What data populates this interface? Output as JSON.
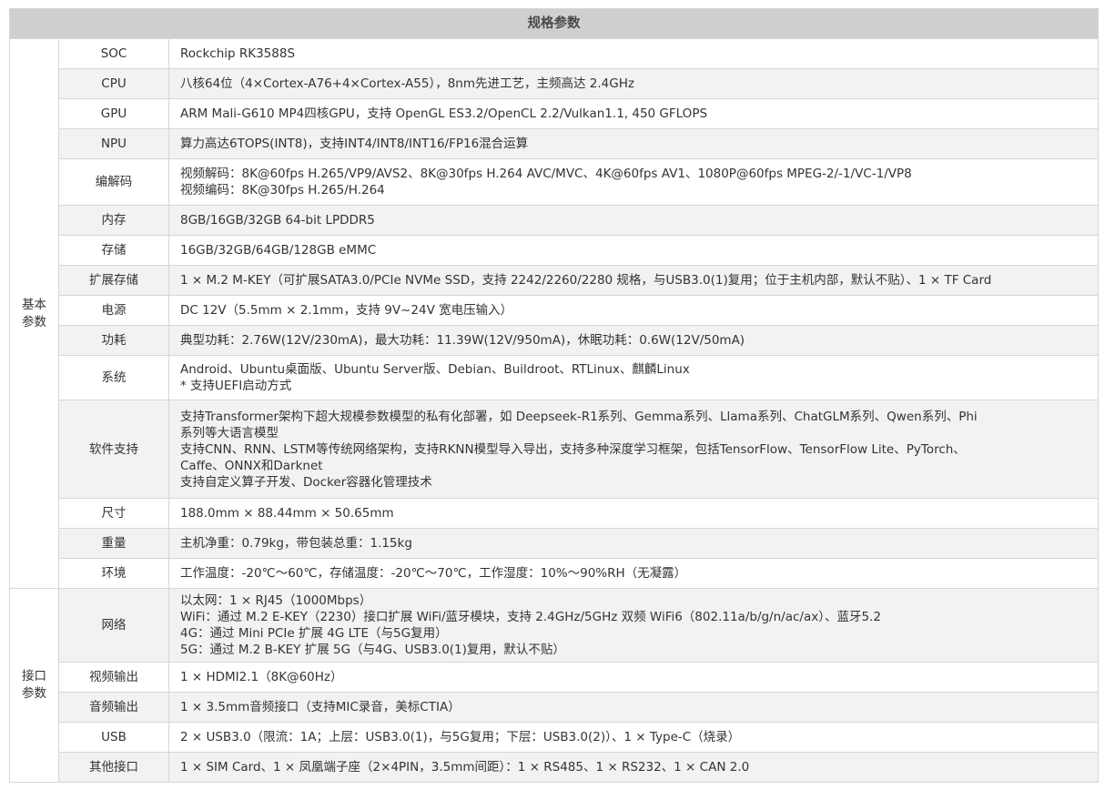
{
  "title": "规格参数",
  "groups": [
    {
      "name": "基本参数",
      "name_lines": [
        "基本",
        "参数"
      ],
      "rows": [
        {
          "label": "SOC",
          "lines": [
            "Rockchip RK3588S"
          ]
        },
        {
          "label": "CPU",
          "lines": [
            "八核64位（4×Cortex-A76+4×Cortex-A55），8nm先进工艺，主频高达 2.4GHz"
          ]
        },
        {
          "label": "GPU",
          "lines": [
            "ARM Mali-G610 MP4四核GPU，支持 OpenGL ES3.2/OpenCL 2.2/Vulkan1.1, 450 GFLOPS"
          ]
        },
        {
          "label": "NPU",
          "lines": [
            "算力高达6TOPS(INT8)，支持INT4/INT8/INT16/FP16混合运算"
          ]
        },
        {
          "label": "编解码",
          "lines": [
            "视频解码：8K@60fps H.265/VP9/AVS2、8K@30fps H.264 AVC/MVC、4K@60fps AV1、1080P@60fps MPEG-2/-1/VC-1/VP8",
            "视频编码：8K@30fps H.265/H.264"
          ]
        },
        {
          "label": "内存",
          "lines": [
            "8GB/16GB/32GB 64-bit LPDDR5"
          ]
        },
        {
          "label": "存储",
          "lines": [
            "16GB/32GB/64GB/128GB eMMC"
          ]
        },
        {
          "label": "扩展存储",
          "lines": [
            "1 × M.2 M-KEY（可扩展SATA3.0/PCIe NVMe SSD，支持 2242/2260/2280 规格，与USB3.0(1)复用；位于主机内部，默认不贴）、1 × TF Card"
          ]
        },
        {
          "label": "电源",
          "lines": [
            "DC 12V（5.5mm × 2.1mm，支持 9V~24V 宽电压输入）"
          ]
        },
        {
          "label": "功耗",
          "lines": [
            "典型功耗：2.76W(12V/230mA)，最大功耗：11.39W(12V/950mA)，休眠功耗：0.6W(12V/50mA)"
          ]
        },
        {
          "label": "系统",
          "lines": [
            "Android、Ubuntu桌面版、Ubuntu Server版、Debian、Buildroot、RTLinux、麒麟Linux",
            "* 支持UEFI启动方式"
          ]
        },
        {
          "label": "软件支持",
          "lines": [
            "支持Transformer架构下超大规模参数模型的私有化部署，如 Deepseek-R1系列、Gemma系列、Llama系列、ChatGLM系列、Qwen系列、Phi",
            "系列等大语言模型",
            "支持CNN、RNN、LSTM等传统网络架构，支持RKNN模型导入导出，支持多种深度学习框架，包括TensorFlow、TensorFlow Lite、PyTorch、",
            "Caffe、ONNX和Darknet",
            "支持自定义算子开发、Docker容器化管理技术"
          ]
        },
        {
          "label": "尺寸",
          "lines": [
            "188.0mm × 88.44mm × 50.65mm"
          ]
        },
        {
          "label": "重量",
          "lines": [
            "主机净重：0.79kg，带包装总重：1.15kg"
          ]
        },
        {
          "label": "环境",
          "lines": [
            "工作温度：-20℃～60℃，存储温度：-20℃～70℃，工作湿度：10%～90%RH（无凝露）"
          ]
        }
      ]
    },
    {
      "name": "接口参数",
      "name_lines": [
        "接口",
        "参数"
      ],
      "rows": [
        {
          "label": "网络",
          "lines": [
            "以太网：1 × RJ45（1000Mbps）",
            "WiFi：通过 M.2 E-KEY（2230）接口扩展 WiFi/蓝牙模块，支持 2.4GHz/5GHz 双频 WiFi6（802.11a/b/g/n/ac/ax）、蓝牙5.2",
            "4G：通过 Mini PCIe 扩展 4G LTE（与5G复用）",
            "5G：通过 M.2 B-KEY 扩展 5G（与4G、USB3.0(1)复用，默认不贴）"
          ]
        },
        {
          "label": "视频输出",
          "lines": [
            "1 × HDMI2.1（8K@60Hz）"
          ]
        },
        {
          "label": "音频输出",
          "lines": [
            "1 × 3.5mm音频接口（支持MIC录音，美标CTIA）"
          ]
        },
        {
          "label": "USB",
          "lines": [
            "2 × USB3.0（限流：1A；上层：USB3.0(1)，与5G复用；下层：USB3.0(2)）、1 × Type-C（烧录）"
          ]
        },
        {
          "label": "其他接口",
          "lines": [
            "1 × SIM Card、1 × 凤凰端子座（2×4PIN，3.5mm间距）：1 × RS485、1 × RS232、1 × CAN 2.0"
          ]
        }
      ]
    }
  ]
}
